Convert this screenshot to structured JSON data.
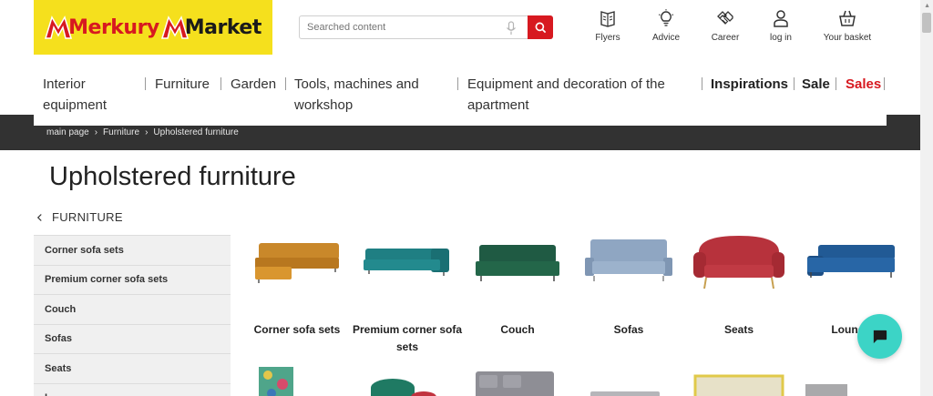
{
  "header": {
    "logo_text_part1": "Merkury",
    "logo_text_part2": "Market",
    "search_placeholder": "Searched content",
    "utilities": [
      {
        "label": "Flyers",
        "icon": "flyers-icon"
      },
      {
        "label": "Advice",
        "icon": "lightbulb-icon"
      },
      {
        "label": "Career",
        "icon": "handshake-icon"
      },
      {
        "label": "log in",
        "icon": "user-icon"
      },
      {
        "label": "Your basket",
        "icon": "basket-icon"
      }
    ]
  },
  "nav": {
    "items": [
      {
        "line1": "Interior",
        "line2": "equipment"
      },
      {
        "line1": "Furniture"
      },
      {
        "line1": "Garden"
      },
      {
        "line1": "Tools, machines and",
        "line2": "workshop"
      },
      {
        "line1": "Equipment and decoration of the",
        "line2": "apartment"
      },
      {
        "line1": "Inspirations"
      },
      {
        "line1": "Sale"
      },
      {
        "line1": "Sales"
      }
    ]
  },
  "breadcrumb": [
    "main page",
    "Furniture",
    "Upholstered furniture"
  ],
  "page_title": "Upholstered furniture",
  "back_label": "FURNITURE",
  "sidebar": {
    "items": [
      "Corner sofa sets",
      "Premium corner sofa sets",
      "Couch",
      "Sofas",
      "Seats",
      "L"
    ]
  },
  "categories": [
    {
      "label_line1": "Corner sofa sets",
      "color": "#c9882a"
    },
    {
      "label_line1": "Premium corner sofa",
      "label_line2": "sets",
      "color": "#1f7f83"
    },
    {
      "label_line1": "Couch",
      "color": "#1f5a43"
    },
    {
      "label_line1": "Sofas",
      "color": "#8fa6c2"
    },
    {
      "label_line1": "Seats",
      "color": "#b7323c"
    },
    {
      "label_line1": "Lounge",
      "color": "#215a95"
    }
  ],
  "colors": {
    "brand_yellow": "#f5e01d",
    "brand_red": "#d71920",
    "dark_bar": "#323232",
    "chat_teal": "#3cd4c6"
  }
}
